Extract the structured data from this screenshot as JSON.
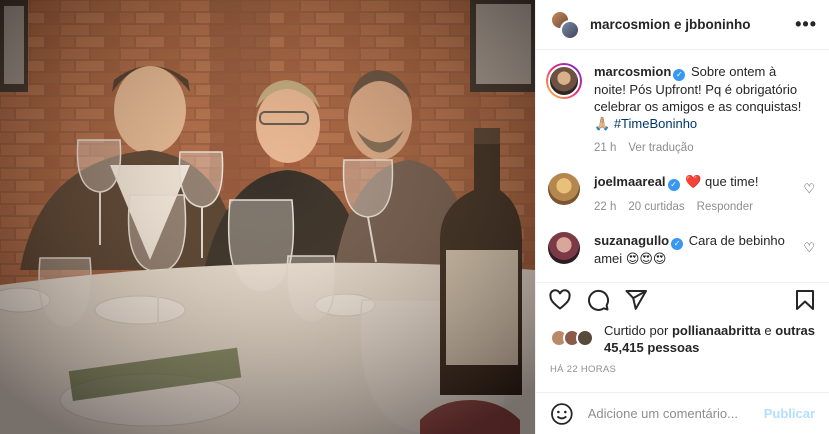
{
  "header": {
    "names": "marcosmion e jbboninho",
    "more_label": "•••"
  },
  "caption": {
    "username": "marcosmion",
    "text": "Sobre ontem à noite! Pós Upfront! Pq é obrigatório celebrar os amigos e as conquistas! 🙏🏼",
    "hashtag": "#TimeBoninho",
    "age": "21 h",
    "translate": "Ver tradução"
  },
  "comments": [
    {
      "username": "joelmaareal",
      "text": "que time!",
      "heart_emoji": "❤️",
      "age": "22 h",
      "likes": "20 curtidas",
      "reply": "Responder"
    },
    {
      "username": "suzanagullo",
      "text": "Cara de bebinho amei",
      "emojis": "😍😍😍"
    }
  ],
  "likes": {
    "prefix": "Curtido por",
    "user": "pollianaabritta",
    "middle": "e",
    "others": "outras 45,415 pessoas"
  },
  "posted": "HÁ 22 HORAS",
  "add_comment": {
    "placeholder": "Adicione um comentário...",
    "post_label": "Publicar"
  },
  "icons": {
    "like": "heart-icon",
    "comment": "comment-icon",
    "share": "send-icon",
    "save": "bookmark-icon",
    "emoji": "emoji-icon"
  },
  "colors": {
    "verified": "#3897f0",
    "hashtag": "#00376b",
    "publish": "#b2dffc",
    "like_red": "#ed4956"
  }
}
